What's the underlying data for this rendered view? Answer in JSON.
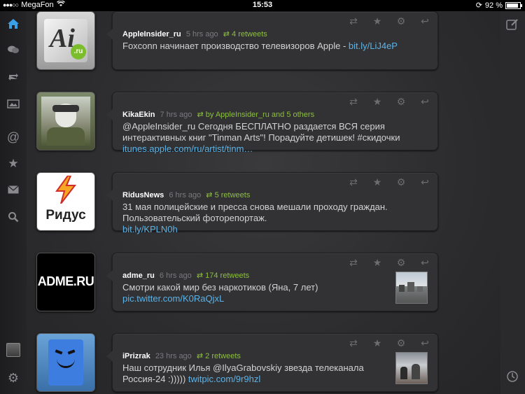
{
  "status_bar": {
    "carrier": "MegaFon",
    "time": "15:53",
    "battery": "92 %",
    "battery_level": 0.92
  },
  "sidebar": {
    "items": [
      "home-icon",
      "chat-icon",
      "retweet-icon",
      "photos-icon",
      "mentions-icon",
      "favorites-icon",
      "messages-icon",
      "search-icon"
    ],
    "bottom": [
      "profile-avatar",
      "settings-icon"
    ]
  },
  "right_bar": {
    "compose": "compose-icon",
    "history": "clock-icon"
  },
  "tweets": [
    {
      "user": "AppleInsider_ru",
      "ago": "5 hrs ago",
      "retweet_info": "4 retweets",
      "text": "Foxconn начинает производство телевизоров Apple - ",
      "link": "bit.ly/LiJ4eP",
      "avatar_text": "Ai",
      "avatar_badge": ".ru"
    },
    {
      "user": "KikaEkin",
      "ago": "7 hrs ago",
      "retweet_info": "by AppleInsider_ru and 5 others",
      "text": "@AppleInsider_ru Сегодня БЕСПЛАТНО раздается ВСЯ серия интерактивных книг \"Tinman Arts\"! Порадуйте детишек! #скидочки ",
      "link": "itunes.apple.com/ru/artist/tinm…"
    },
    {
      "user": "RidusNews",
      "ago": "6 hrs ago",
      "retweet_info": "5 retweets",
      "text": "31 мая полицейские и пресса снова мешали проходу граждан. Пользовательский фоторепортаж.",
      "link": "bit.ly/KPLN0h",
      "avatar_text": "Ридус"
    },
    {
      "user": "adme_ru",
      "ago": "6 hrs ago",
      "retweet_info": "174 retweets",
      "text": "Смотри какой мир без наркотиков (Яна, 7 лет)",
      "link": "pic.twitter.com/K0RaQjxL",
      "avatar_text": "ADME.RU"
    },
    {
      "user": "iPrizrak",
      "ago": "23 hrs ago",
      "retweet_info": "2 retweets",
      "text_a": "Наш сотрудник Илья ",
      "mention": "@IlyaGrabovskiy",
      "text_b": " звезда телеканала Россия-24 :)))))  ",
      "link": "twitpic.com/9r9hzl"
    }
  ],
  "colors": {
    "background": "#2b2b2d",
    "link": "#5bb3e8",
    "retweet": "#8cbf3f"
  }
}
